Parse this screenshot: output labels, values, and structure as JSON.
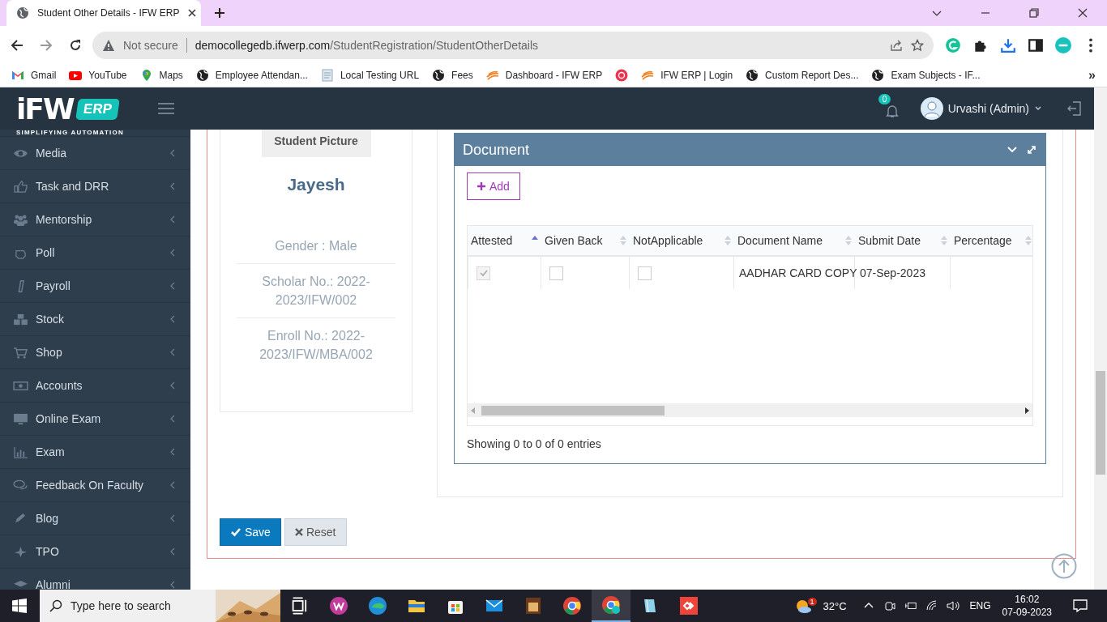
{
  "browser": {
    "tab_title": "Student Other Details - IFW ERP",
    "security": "Not secure",
    "url_host": "democollegedb.ifwerp.com",
    "url_path": "/StudentRegistration/StudentOtherDetails",
    "bookmarks": [
      {
        "kind": "gmail",
        "label": "Gmail"
      },
      {
        "kind": "youtube",
        "label": "YouTube"
      },
      {
        "kind": "pin",
        "label": "Maps"
      },
      {
        "kind": "globe",
        "label": "Employee Attendan..."
      },
      {
        "kind": "doc",
        "label": "Local Testing URL"
      },
      {
        "kind": "globe",
        "label": "Fees"
      },
      {
        "kind": "swoosh",
        "label": "Dashboard - IFW ERP"
      },
      {
        "kind": "target"
      },
      {
        "kind": "swoosh",
        "label": "IFW ERP | Login"
      },
      {
        "kind": "globe",
        "label": "Custom Report Des..."
      },
      {
        "kind": "globe",
        "label": "Exam Subjects - IF..."
      }
    ],
    "more": "»"
  },
  "brand": {
    "name": "iFW",
    "badge": "ERP",
    "tagline": "SIMPLIFYING AUTOMATION"
  },
  "header": {
    "notifications": "0",
    "user": "Urvashi (Admin)"
  },
  "sidebar": {
    "items": [
      {
        "label": "Media"
      },
      {
        "label": "Task and DRR"
      },
      {
        "label": "Mentorship"
      },
      {
        "label": "Poll"
      },
      {
        "label": "Payroll"
      },
      {
        "label": "Stock"
      },
      {
        "label": "Shop"
      },
      {
        "label": "Accounts"
      },
      {
        "label": "Online Exam"
      },
      {
        "label": "Exam"
      },
      {
        "label": "Feedback On Faculty"
      },
      {
        "label": "Blog"
      },
      {
        "label": "TPO"
      },
      {
        "label": "Alumni"
      }
    ]
  },
  "student": {
    "picture_label": "Student Picture",
    "name": "Jayesh",
    "details": [
      "Gender : Male",
      "Scholar No.: 2022-2023/IFW/002",
      "Enroll No.: 2022-2023/IFW/MBA/002"
    ]
  },
  "document": {
    "title": "Document",
    "add": "Add",
    "columns": [
      {
        "label": "Attested",
        "sorted": true
      },
      {
        "label": "Given Back",
        "sorted": false
      },
      {
        "label": "NotApplicable",
        "sorted": false
      },
      {
        "label": "Document Name",
        "sorted": false
      },
      {
        "label": "Submit Date",
        "sorted": false
      },
      {
        "label": "Percentage",
        "sorted": false
      }
    ],
    "rows": [
      {
        "cells": [
          {
            "kind": "checkbox",
            "checked": true,
            "disabled": true
          },
          {
            "kind": "checkbox",
            "checked": false,
            "disabled": false
          },
          {
            "kind": "checkbox",
            "checked": false,
            "disabled": false
          },
          {
            "kind": "text",
            "text": "AADHAR CARD COPY"
          },
          {
            "kind": "text",
            "text": "07-Sep-2023"
          },
          {
            "kind": "blank"
          }
        ]
      }
    ],
    "info": "Showing 0 to 0 of 0 entries"
  },
  "buttons": [
    {
      "kind": "primary",
      "label": "Save"
    },
    {
      "kind": "default",
      "label": "Reset"
    }
  ],
  "taskbar": {
    "search_placeholder": "Type here to search",
    "weather_badge": "1",
    "temperature": "32°C",
    "language": "ENG",
    "time": "16:02",
    "date": "07-09-2023"
  }
}
